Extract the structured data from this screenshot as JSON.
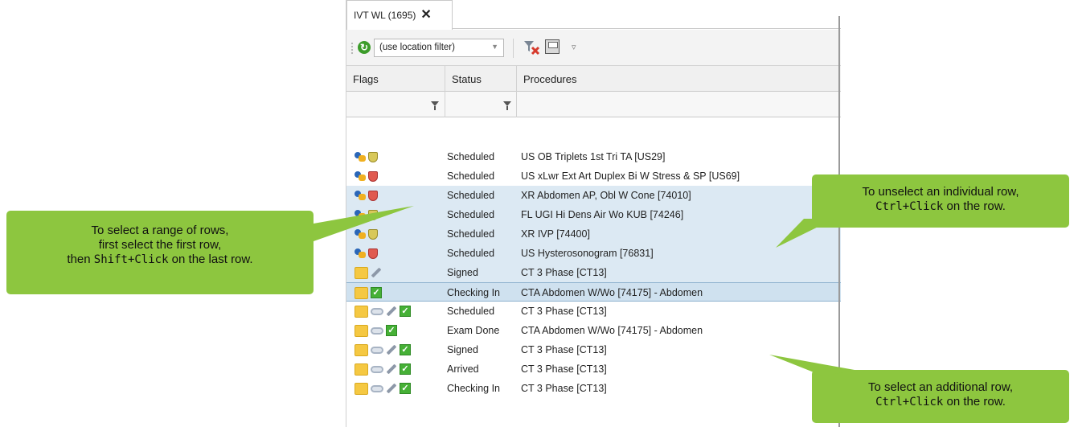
{
  "tab": {
    "title": "IVT WL (1695)",
    "close": "✕"
  },
  "toolbar": {
    "location_filter": "(use location filter)",
    "refresh_icon": "refresh-icon",
    "filter_clear_icon": "filter-clear-icon",
    "save_icon": "save-icon",
    "overflow_icon": "overflow-icon"
  },
  "columns": [
    "Flags",
    "Status",
    "Procedures"
  ],
  "rows": [
    {
      "flags": [
        "person",
        "shield-ok"
      ],
      "status": "Scheduled",
      "procedure": "US OB Triplets 1st Tri TA [US29]",
      "state": "normal"
    },
    {
      "flags": [
        "person",
        "shield-bad"
      ],
      "status": "Scheduled",
      "procedure": "US xLwr Ext Art Duplex Bi W Stress & SP [US69]",
      "state": "normal"
    },
    {
      "flags": [
        "person",
        "shield-bad"
      ],
      "status": "Scheduled",
      "procedure": "XR Abdomen AP, Obl W Cone [74010]",
      "state": "selected"
    },
    {
      "flags": [
        "person",
        "shield-ok"
      ],
      "status": "Scheduled",
      "procedure": "FL UGI Hi Dens Air Wo KUB [74246]",
      "state": "selected"
    },
    {
      "flags": [
        "person",
        "shield-ok"
      ],
      "status": "Scheduled",
      "procedure": "XR IVP [74400]",
      "state": "selected"
    },
    {
      "flags": [
        "person",
        "shield-bad"
      ],
      "status": "Scheduled",
      "procedure": "US Hysterosonogram [76831]",
      "state": "selected"
    },
    {
      "flags": [
        "folder",
        "pencil"
      ],
      "status": "Signed",
      "procedure": "CT 3 Phase [CT13]",
      "state": "selected"
    },
    {
      "flags": [
        "folder",
        "check"
      ],
      "status": "Checking In",
      "procedure": "CTA Abdomen W/Wo [74175] - Abdomen",
      "state": "current"
    },
    {
      "flags": [
        "folder",
        "link",
        "pencil",
        "check"
      ],
      "status": "Scheduled",
      "procedure": "CT 3 Phase [CT13]",
      "state": "normal"
    },
    {
      "flags": [
        "folder",
        "link",
        "check"
      ],
      "status": "Exam Done",
      "procedure": "CTA Abdomen W/Wo [74175] - Abdomen",
      "state": "normal"
    },
    {
      "flags": [
        "folder",
        "link",
        "pencil",
        "check"
      ],
      "status": "Signed",
      "procedure": "CT 3 Phase [CT13]",
      "state": "normal"
    },
    {
      "flags": [
        "folder",
        "link",
        "pencil",
        "check"
      ],
      "status": "Arrived",
      "procedure": "CT 3 Phase [CT13]",
      "state": "normal"
    },
    {
      "flags": [
        "folder",
        "link",
        "pencil",
        "check"
      ],
      "status": "Checking In",
      "procedure": "CT 3 Phase [CT13]",
      "state": "normal"
    }
  ],
  "callouts": {
    "range": {
      "line1": "To select a range of rows,",
      "line2": "first select the first row,",
      "line3_pre": "then ",
      "line3_key": "Shift+Click",
      "line3_post": " on the last row."
    },
    "unselect": {
      "line1": "To unselect an individual row,",
      "line2_key": "Ctrl+Click",
      "line2_post": " on the row."
    },
    "additional": {
      "line1": "To select an additional row,",
      "line2_key": "Ctrl+Click",
      "line2_post": " on the row."
    }
  },
  "colors": {
    "callout": "#8dc63f",
    "selected_row": "#dce9f3",
    "current_row": "#cfe1ef"
  }
}
